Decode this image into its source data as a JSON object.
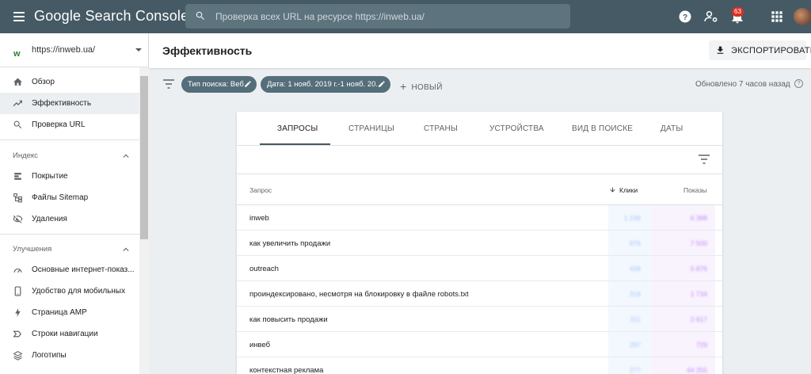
{
  "app": {
    "title": "Google Search Console"
  },
  "search": {
    "placeholder": "Проверка всех URL на ресурсе https://inweb.ua/"
  },
  "notifications": {
    "count": "63"
  },
  "property": {
    "url": "https://inweb.ua/",
    "icon_letter": "w"
  },
  "sidebar": {
    "items": [
      {
        "label": "Обзор",
        "icon": "home-icon"
      },
      {
        "label": "Эффективность",
        "icon": "trending-up-icon",
        "active": true
      },
      {
        "label": "Проверка URL",
        "icon": "search-icon"
      }
    ],
    "index": {
      "title": "Индекс",
      "items": [
        {
          "label": "Покрытие",
          "icon": "coverage-icon"
        },
        {
          "label": "Файлы Sitemap",
          "icon": "sitemap-icon"
        },
        {
          "label": "Удаления",
          "icon": "removals-icon"
        }
      ]
    },
    "enhancements": {
      "title": "Улучшения",
      "items": [
        {
          "label": "Основные интернет-показ...",
          "icon": "gauge-icon"
        },
        {
          "label": "Удобство для мобильных",
          "icon": "mobile-icon"
        },
        {
          "label": "Страница AMP",
          "icon": "amp-icon"
        },
        {
          "label": "Строки навигации",
          "icon": "breadcrumbs-icon"
        },
        {
          "label": "Логотипы",
          "icon": "logo-layers-icon"
        }
      ]
    }
  },
  "header": {
    "title": "Эффективность",
    "export_label": "ЭКСПОРТИРОВАТЬ"
  },
  "filters": {
    "search_type": "Тип поиска: Веб",
    "date": "Дата: 1 нояб. 2019 г.-1 нояб. 20...",
    "new_label": "НОВЫЙ",
    "updated": "Обновлено 7 часов назад"
  },
  "tabs": [
    "ЗАПРОСЫ",
    "СТРАНИЦЫ",
    "СТРАНЫ",
    "УСТРОЙСТВА",
    "ВИД В ПОИСКЕ",
    "ДАТЫ"
  ],
  "table": {
    "headers": {
      "query": "Запрос",
      "clicks": "Клики",
      "impressions": "Показы"
    },
    "rows": [
      {
        "query": "inweb",
        "clicks": "1 248",
        "impressions": "6 388"
      },
      {
        "query": "как увеличить продажи",
        "clicks": "876",
        "impressions": "7 500"
      },
      {
        "query": "outreach",
        "clicks": "439",
        "impressions": "5 876"
      },
      {
        "query": "проиндексировано, несмотря на блокировку в файле robots.txt",
        "clicks": "318",
        "impressions": "1 734"
      },
      {
        "query": "как повысить продажи",
        "clicks": "311",
        "impressions": "2 617"
      },
      {
        "query": "инвеб",
        "clicks": "297",
        "impressions": "729"
      },
      {
        "query": "контекстная реклама",
        "clicks": "277",
        "impressions": "44 255"
      }
    ]
  },
  "colors": {
    "topbar": "#455a64",
    "chip": "#546e7a",
    "clicks": "#4285f4",
    "impressions": "#a142f4"
  }
}
